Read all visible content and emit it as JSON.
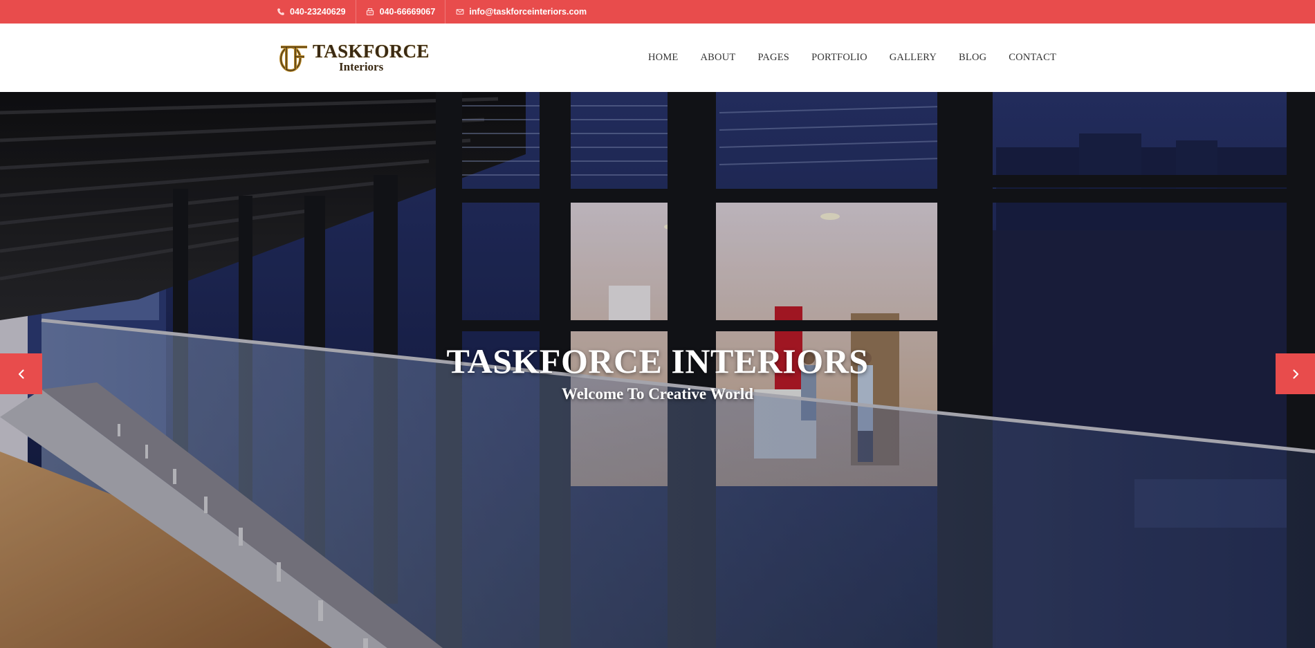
{
  "topbar": {
    "phone1": "040-23240629",
    "phone2": "040-66669067",
    "email": "info@taskforceinteriors.com",
    "icons": [
      "phone-icon",
      "fax-icon",
      "envelope-icon"
    ],
    "color": "#e84c4c"
  },
  "logo": {
    "line1": "TASKFORCE",
    "line2": "Interiors"
  },
  "nav": [
    "HOME",
    "ABOUT",
    "PAGES",
    "PORTFOLIO",
    "GALLERY",
    "BLOG",
    "CONTACT"
  ],
  "hero": {
    "title": "TASKFORCE INTERIORS",
    "subtitle": "Welcome To Creative World",
    "prev_icon": "chevron-left-icon",
    "next_icon": "chevron-right-icon",
    "accent": "#e84c4c"
  }
}
